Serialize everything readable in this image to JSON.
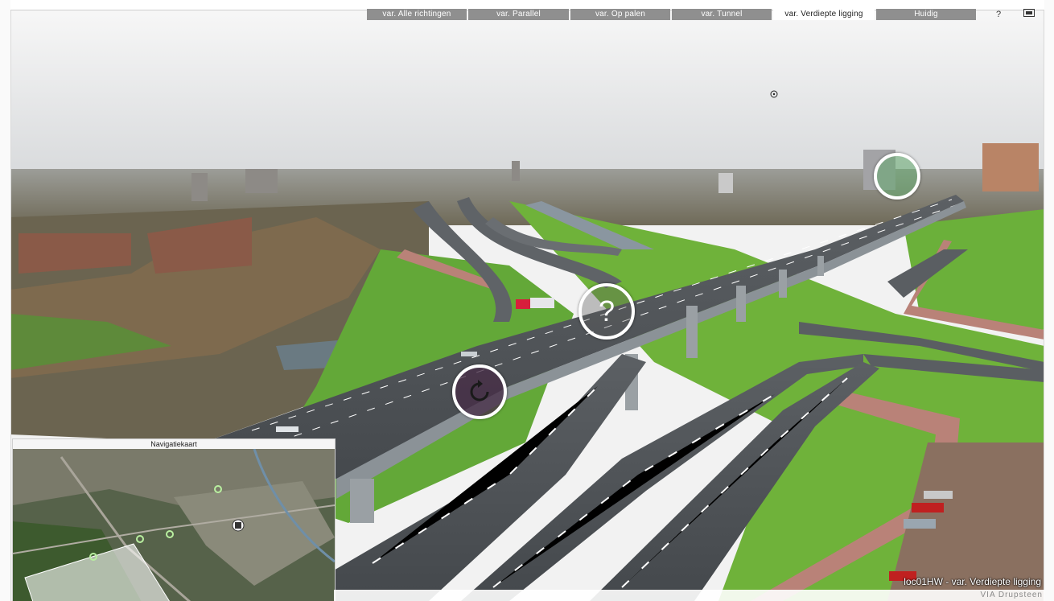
{
  "toolbar": {
    "tabs": [
      {
        "label": "var. Alle richtingen",
        "active": false
      },
      {
        "label": "var. Parallel",
        "active": false
      },
      {
        "label": "var. Op palen",
        "active": false
      },
      {
        "label": "var. Tunnel",
        "active": false
      },
      {
        "label": "var. Verdiepte ligging",
        "active": true
      },
      {
        "label": "Huidig",
        "active": false
      }
    ],
    "help_label": "?",
    "fullscreen_icon": "fullscreen-icon"
  },
  "hotspots": {
    "help_symbol": "?",
    "help_icon": "help-hotspot-icon",
    "rotate_icon": "rotate-icon",
    "location_icon": "location-hotspot-icon"
  },
  "minimap": {
    "title": "Navigatiekaart"
  },
  "caption": "loc01HW - var. Verdiepte ligging",
  "brand": "VIA Drupsteen",
  "colors": {
    "tab_inactive": "#8f8f8f",
    "tab_active": "#ffffff",
    "grass": "#6fb23a",
    "road": "#4b4f52",
    "bike_path": "#b98278",
    "sky": "#ececec"
  }
}
